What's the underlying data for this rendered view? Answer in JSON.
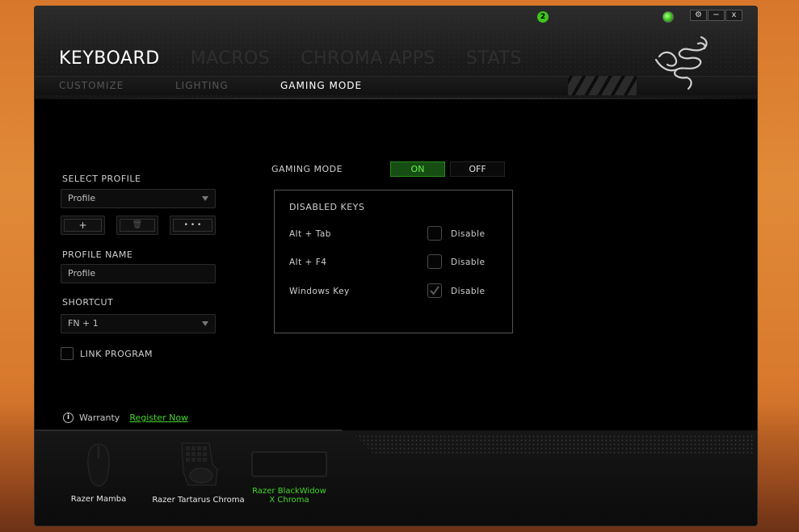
{
  "window": {
    "notification_count": "2",
    "buttons": {
      "settings": "⚙",
      "minimize": "−",
      "close": "x"
    }
  },
  "main_tabs": [
    {
      "label": "KEYBOARD",
      "active": true
    },
    {
      "label": "MACROS",
      "active": false
    },
    {
      "label": "CHROMA APPS",
      "active": false
    },
    {
      "label": "STATS",
      "active": false
    }
  ],
  "sub_tabs": [
    {
      "label": "CUSTOMIZE",
      "active": false
    },
    {
      "label": "LIGHTING",
      "active": false
    },
    {
      "label": "GAMING MODE",
      "active": true
    }
  ],
  "left_panel": {
    "select_profile_label": "SELECT PROFILE",
    "profile_value": "Profile",
    "add_button": "+",
    "delete_button": "🗑",
    "more_button": "• • •",
    "profile_name_label": "PROFILE NAME",
    "profile_name_value": "Profile",
    "shortcut_label": "SHORTCUT",
    "shortcut_value": "FN + 1",
    "link_program_label": "LINK PROGRAM",
    "link_program_checked": false
  },
  "gaming_mode": {
    "label": "GAMING MODE",
    "on_label": "ON",
    "off_label": "OFF",
    "state": "ON",
    "disabled_keys_title": "DISABLED KEYS",
    "keys": [
      {
        "name": "Alt + Tab",
        "action": "Disable",
        "checked": false
      },
      {
        "name": "Alt + F4",
        "action": "Disable",
        "checked": false
      },
      {
        "name": "Windows Key",
        "action": "Disable",
        "checked": true
      }
    ]
  },
  "footer": {
    "warranty_label": "Warranty",
    "register_link": "Register Now"
  },
  "devices": [
    {
      "name": "Razer Mamba",
      "icon": "mouse-icon",
      "active": false
    },
    {
      "name": "Razer Tartarus Chroma",
      "icon": "keypad-icon",
      "active": false
    },
    {
      "name": "Razer BlackWidow X Chroma",
      "icon": "keyboard-icon",
      "active": true
    }
  ],
  "colors": {
    "accent": "#44d62c",
    "background": "#000000",
    "toggle_on_bg": "#154d12"
  }
}
